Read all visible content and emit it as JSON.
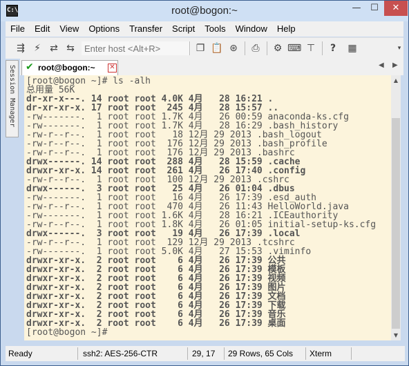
{
  "window": {
    "title": "root@bogon:~",
    "icon_text": "C:\\",
    "minimize": "—",
    "maximize": "☐",
    "close": "✕"
  },
  "menu": [
    "File",
    "Edit",
    "View",
    "Options",
    "Transfer",
    "Script",
    "Tools",
    "Window",
    "Help"
  ],
  "toolbar": {
    "host_placeholder": "Enter host <Alt+R>",
    "icons": [
      "connect-icon",
      "quick-connect-icon",
      "reconnect-icon",
      "disconnect-icon",
      "copy-icon",
      "paste-icon",
      "find-icon",
      "print-icon",
      "settings-icon",
      "keymap-icon",
      "sftp-icon",
      "help-icon",
      "map-icon",
      "dropdown-icon"
    ]
  },
  "session_manager": "Session Manager",
  "tab": {
    "label": "root@bogon:~"
  },
  "terminal": {
    "lines": [
      {
        "text": "[root@bogon ~]# ls -alh"
      },
      {
        "text": "总用量 56K"
      },
      {
        "text": "dr-xr-x---. 14 root root 4.0K 4月   28 16:21 .",
        "bold_name": true
      },
      {
        "text": "dr-xr-xr-x. 17 root root  245 4月   28 15:57 ..",
        "bold_name": true
      },
      {
        "text": "-rw-------.  1 root root 1.7K 4月   26 00:59 anaconda-ks.cfg"
      },
      {
        "text": "-rw-------.  1 root root 1.7K 4月   28 16:29 .bash_history"
      },
      {
        "text": "-rw-r--r--.  1 root root   18 12月 29 2013 .bash_logout"
      },
      {
        "text": "-rw-r--r--.  1 root root  176 12月 29 2013 .bash_profile"
      },
      {
        "text": "-rw-r--r--.  1 root root  176 12月 29 2013 .bashrc"
      },
      {
        "text": "drwx------. 14 root root  288 4月   28 15:59 .cache",
        "bold_name": true
      },
      {
        "text": "drwxr-xr-x. 14 root root  261 4月   26 17:40 .config",
        "bold_name": true
      },
      {
        "text": "-rw-r--r--.  1 root root  100 12月 29 2013 .cshrc"
      },
      {
        "text": "drwx------.  3 root root   25 4月   26 01:04 .dbus",
        "bold_name": true
      },
      {
        "text": "-rw-------.  1 root root   16 4月   26 17:39 .esd_auth"
      },
      {
        "text": "-rw-r--r--.  1 root root  470 4月   26 11:43 HelloWorld.java"
      },
      {
        "text": "-rw-------.  1 root root 1.6K 4月   28 16:21 .ICEauthority"
      },
      {
        "text": "-rw-r--r--.  1 root root 1.8K 4月   26 01:05 initial-setup-ks.cfg"
      },
      {
        "text": "drwx------.  3 root root   19 4月   26 17:39 .local",
        "bold_name": true
      },
      {
        "text": "-rw-r--r--.  1 root root  129 12月 29 2013 .tcshrc"
      },
      {
        "text": "-rw-------.  1 root root 5.0K 4月   27 15:53 .viminfo"
      },
      {
        "text": "drwxr-xr-x.  2 root root    6 4月   26 17:39 公共",
        "bold_name": true
      },
      {
        "text": "drwxr-xr-x.  2 root root    6 4月   26 17:39 模板",
        "bold_name": true
      },
      {
        "text": "drwxr-xr-x.  2 root root    6 4月   26 17:39 视频",
        "bold_name": true
      },
      {
        "text": "drwxr-xr-x.  2 root root    6 4月   26 17:39 图片",
        "bold_name": true
      },
      {
        "text": "drwxr-xr-x.  2 root root    6 4月   26 17:39 文档",
        "bold_name": true
      },
      {
        "text": "drwxr-xr-x.  2 root root    6 4月   26 17:39 下载",
        "bold_name": true
      },
      {
        "text": "drwxr-xr-x.  2 root root    6 4月   26 17:39 音乐",
        "bold_name": true
      },
      {
        "text": "drwxr-xr-x.  2 root root    6 4月   26 17:39 桌面",
        "bold_name": true
      },
      {
        "text": "[root@bogon ~]#"
      }
    ]
  },
  "status": {
    "ready": "Ready",
    "cipher": "ssh2: AES-256-CTR",
    "cursor": "29, 17",
    "size": "29 Rows, 65 Cols",
    "term": "Xterm"
  },
  "colors": {
    "terminal_bg": "#fcf4dc",
    "terminal_fg": "#555555",
    "frame": "#c9d9ee",
    "close_button": "#c75050"
  }
}
